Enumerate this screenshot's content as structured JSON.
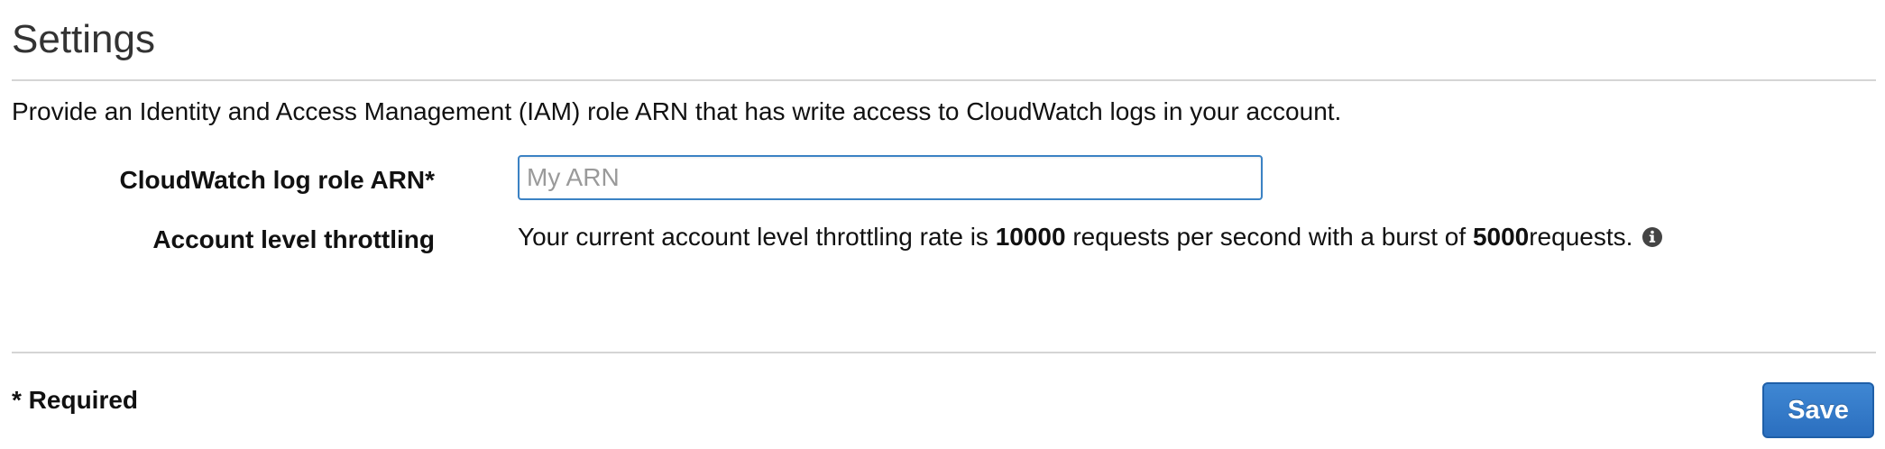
{
  "page": {
    "title": "Settings",
    "description": "Provide an Identity and Access Management (IAM) role ARN that has write access to CloudWatch logs in your account."
  },
  "form": {
    "arn_label": "CloudWatch log role ARN*",
    "arn_placeholder": "My ARN",
    "arn_value": "",
    "throttle_label": "Account level throttling",
    "throttle_text_prefix": "Your current account level throttling rate is ",
    "throttle_rate": "10000",
    "throttle_text_middle": " requests per second with a burst of ",
    "throttle_burst": "5000",
    "throttle_text_suffix": " requests.",
    "info_icon": "info-circle-icon"
  },
  "footer": {
    "required_note": "* Required",
    "save_label": "Save"
  },
  "colors": {
    "accent": "#2b6fbf",
    "input_border": "#3b82c4",
    "divider": "#d5d5d5"
  }
}
